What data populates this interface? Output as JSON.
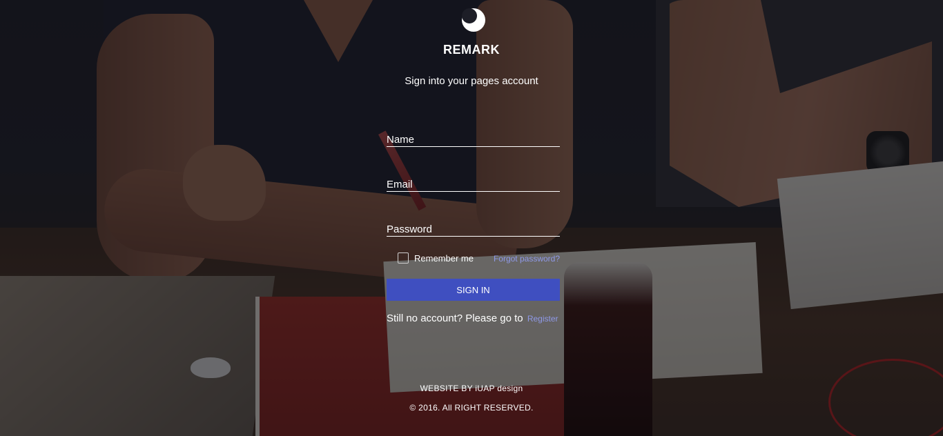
{
  "brand": {
    "logo_icon": "crescent-logo-icon",
    "name": "REMARK",
    "subtitle": "Sign into your pages account"
  },
  "form": {
    "name_placeholder": "Name",
    "email_placeholder": "Email",
    "password_placeholder": "Password",
    "remember_label": "Remember me",
    "remember_checked": false,
    "forgot_label": "Forgot password?",
    "submit_label": "SIGN IN",
    "register_prompt": "Still no account? Please go to",
    "register_link": "Register"
  },
  "footer": {
    "credit": "WEBSITE BY iUAP design",
    "copyright": "© 2016. All RIGHT RESERVED."
  },
  "colors": {
    "primary_button": "#3f4fc0",
    "link": "#8f99e8",
    "text": "#ffffff",
    "overlay": "rgba(12,12,18,0.55)"
  }
}
